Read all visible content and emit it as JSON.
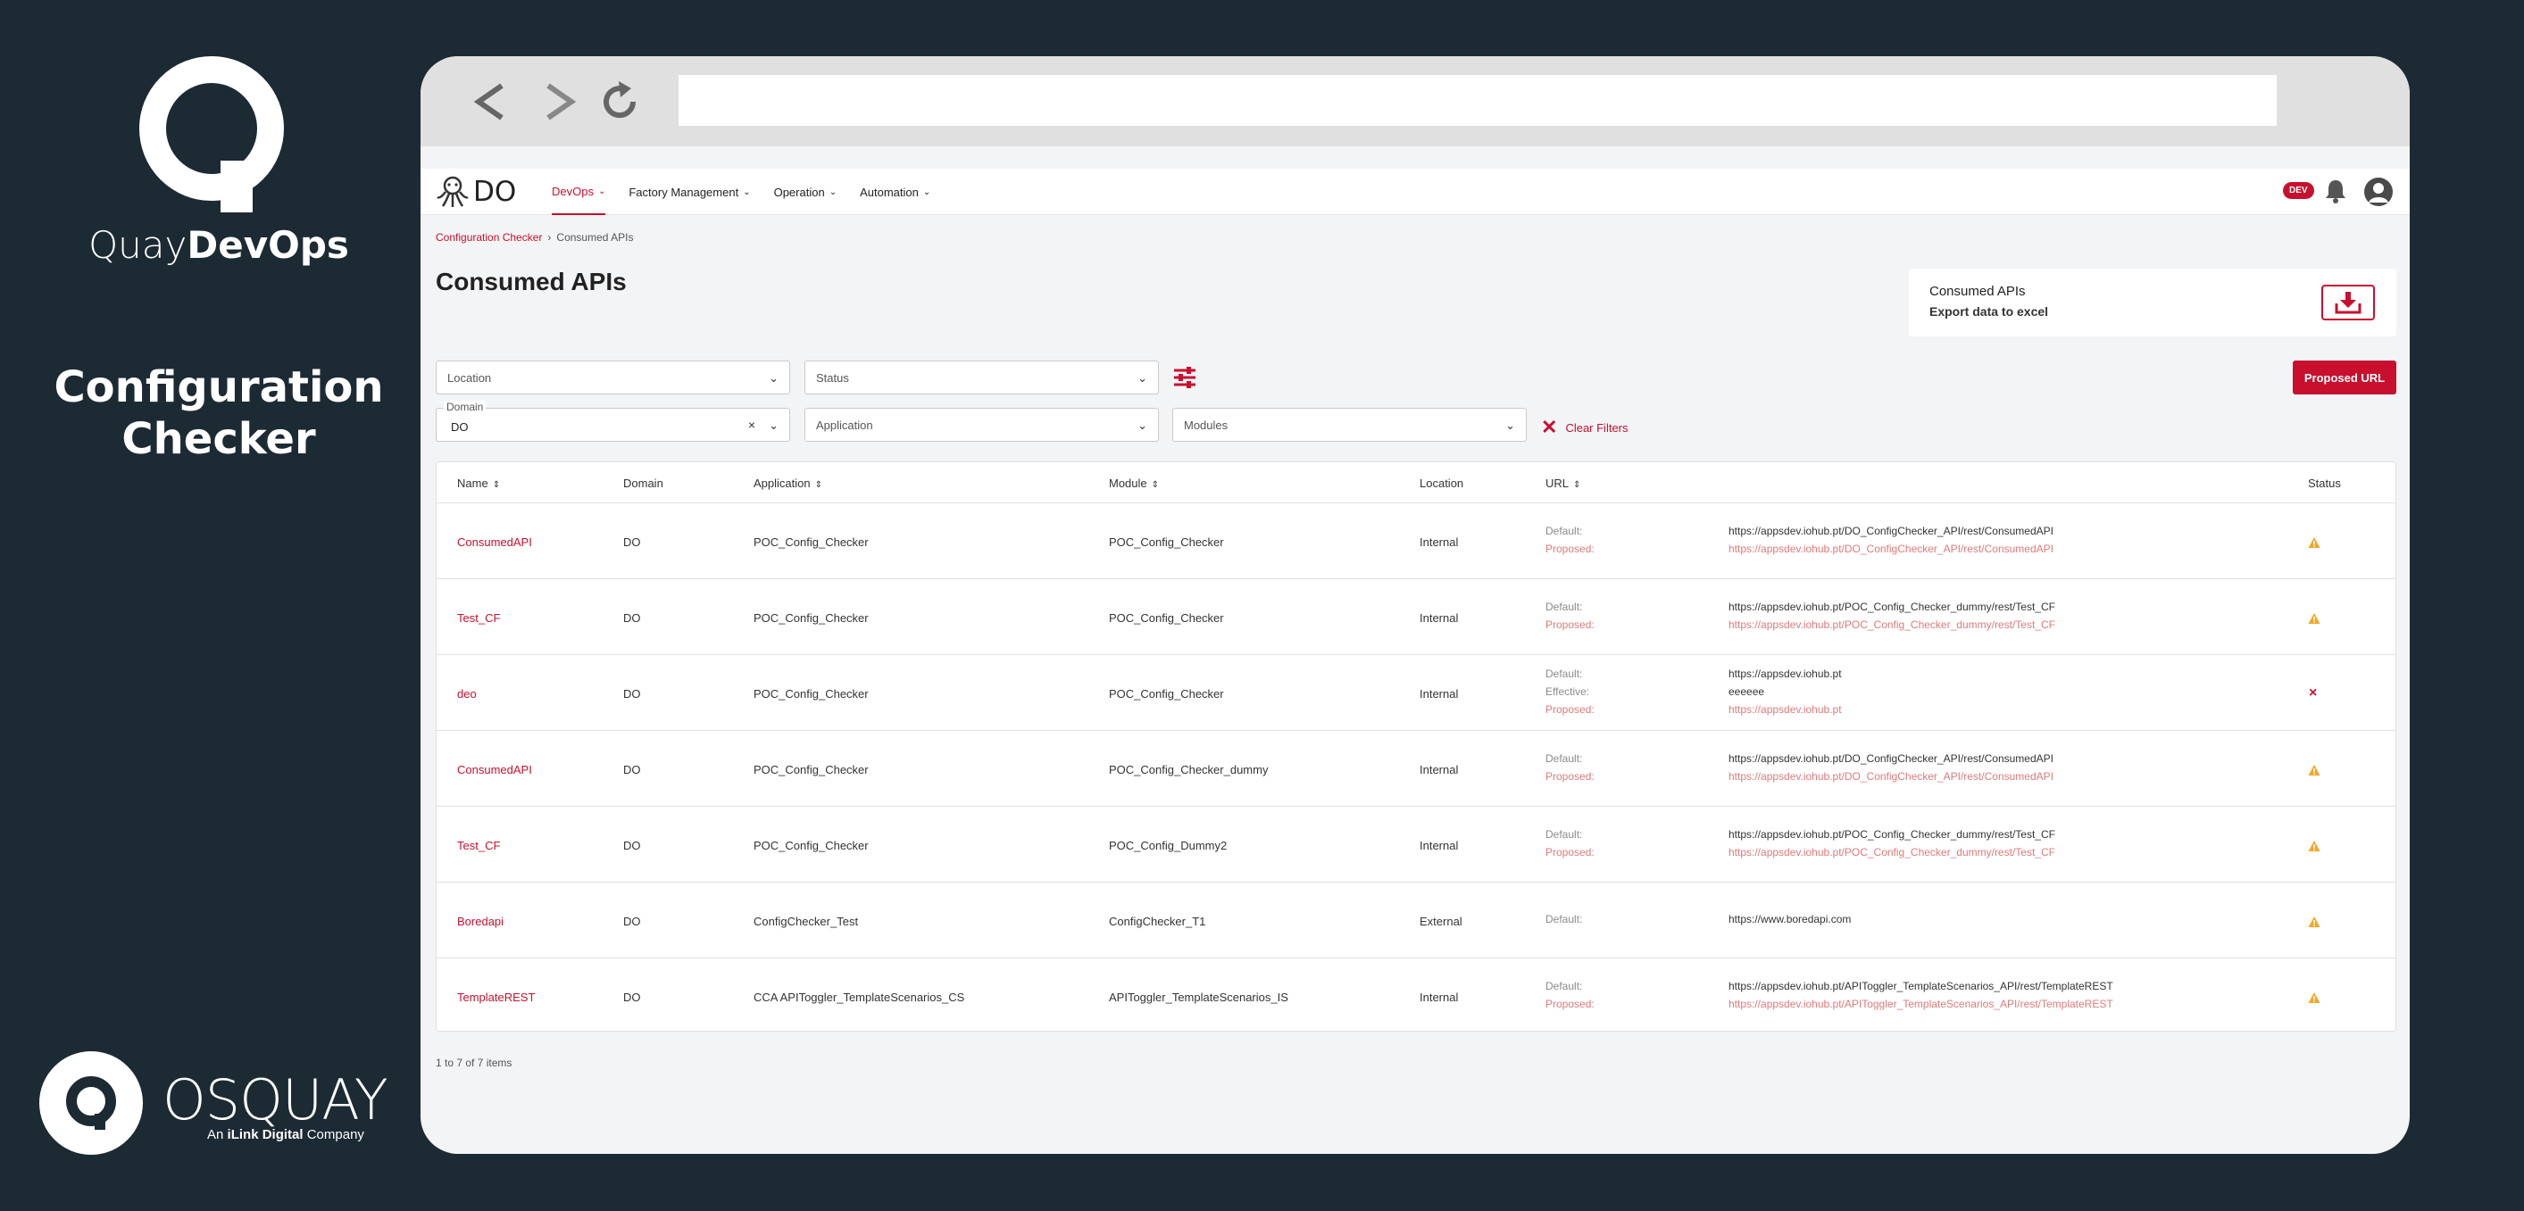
{
  "branding": {
    "name_light": "Quay",
    "name_bold": "DevOps",
    "product_title_line1": "Configuration",
    "product_title_line2": "Checker",
    "company": "OSQUAY",
    "company_sub_prefix": "An",
    "company_sub_bold": "iLink Digital",
    "company_sub_suffix": "Company"
  },
  "app": {
    "logo_text": "DO",
    "menu": [
      {
        "label": "DevOps",
        "active": true
      },
      {
        "label": "Factory Management",
        "active": false
      },
      {
        "label": "Operation",
        "active": false
      },
      {
        "label": "Automation",
        "active": false
      }
    ],
    "env_badge": "DEV"
  },
  "breadcrumb": {
    "parent": "Configuration Checker",
    "separator": "›",
    "current": "Consumed APIs"
  },
  "page_title": "Consumed APIs",
  "export": {
    "title": "Consumed APIs",
    "subtitle": "Export data to excel"
  },
  "filters": {
    "location_placeholder": "Location",
    "status_placeholder": "Status",
    "domain_legend": "Domain",
    "domain_value": "DO",
    "application_placeholder": "Application",
    "modules_placeholder": "Modules",
    "clear_filters": "Clear Filters",
    "proposed_url_button": "Proposed URL"
  },
  "table": {
    "headers": {
      "name": "Name",
      "domain": "Domain",
      "application": "Application",
      "module": "Module",
      "location": "Location",
      "url": "URL",
      "status": "Status"
    },
    "rows": [
      {
        "name": "ConsumedAPI",
        "domain": "DO",
        "application": "POC_Config_Checker",
        "module": "POC_Config_Checker",
        "location": "Internal",
        "url_labels": [
          "Default:",
          "Proposed:"
        ],
        "url_values": [
          "https://appsdev.iohub.pt/DO_ConfigChecker_API/rest/ConsumedAPI",
          "https://appsdev.iohub.pt/DO_ConfigChecker_API/rest/ConsumedAPI"
        ],
        "status": "warning"
      },
      {
        "name": "Test_CF",
        "domain": "DO",
        "application": "POC_Config_Checker",
        "module": "POC_Config_Checker",
        "location": "Internal",
        "url_labels": [
          "Default:",
          "Proposed:"
        ],
        "url_values": [
          "https://appsdev.iohub.pt/POC_Config_Checker_dummy/rest/Test_CF",
          "https://appsdev.iohub.pt/POC_Config_Checker_dummy/rest/Test_CF"
        ],
        "status": "warning"
      },
      {
        "name": "deo",
        "domain": "DO",
        "application": "POC_Config_Checker",
        "module": "POC_Config_Checker",
        "location": "Internal",
        "url_labels": [
          "Default:",
          "Effective:",
          "Proposed:"
        ],
        "url_values": [
          "https://appsdev.iohub.pt",
          "eeeeee",
          "https://appsdev.iohub.pt"
        ],
        "status": "error"
      },
      {
        "name": "ConsumedAPI",
        "domain": "DO",
        "application": "POC_Config_Checker",
        "module": "POC_Config_Checker_dummy",
        "location": "Internal",
        "url_labels": [
          "Default:",
          "Proposed:"
        ],
        "url_values": [
          "https://appsdev.iohub.pt/DO_ConfigChecker_API/rest/ConsumedAPI",
          "https://appsdev.iohub.pt/DO_ConfigChecker_API/rest/ConsumedAPI"
        ],
        "status": "warning"
      },
      {
        "name": "Test_CF",
        "domain": "DO",
        "application": "POC_Config_Checker",
        "module": "POC_Config_Dummy2",
        "location": "Internal",
        "url_labels": [
          "Default:",
          "Proposed:"
        ],
        "url_values": [
          "https://appsdev.iohub.pt/POC_Config_Checker_dummy/rest/Test_CF",
          "https://appsdev.iohub.pt/POC_Config_Checker_dummy/rest/Test_CF"
        ],
        "status": "warning"
      },
      {
        "name": "Boredapi",
        "domain": "DO",
        "application": "ConfigChecker_Test",
        "module": "ConfigChecker_T1",
        "location": "External",
        "url_labels": [
          "Default:"
        ],
        "url_values": [
          "https://www.boredapi.com"
        ],
        "status": "warning"
      },
      {
        "name": "TemplateREST",
        "domain": "DO",
        "application": "CCA APIToggler_TemplateScenarios_CS",
        "module": "APIToggler_TemplateScenarios_IS",
        "location": "Internal",
        "url_labels": [
          "Default:",
          "Proposed:"
        ],
        "url_values": [
          "https://appsdev.iohub.pt/APIToggler_TemplateScenarios_API/rest/TemplateREST",
          "https://appsdev.iohub.pt/APIToggler_TemplateScenarios_API/rest/TemplateREST"
        ],
        "status": "warning"
      }
    ]
  },
  "pagination": "1 to 7 of 7 items",
  "colors": {
    "accent": "#c8102e",
    "background": "#1c2a33",
    "warning": "#f5a623"
  }
}
